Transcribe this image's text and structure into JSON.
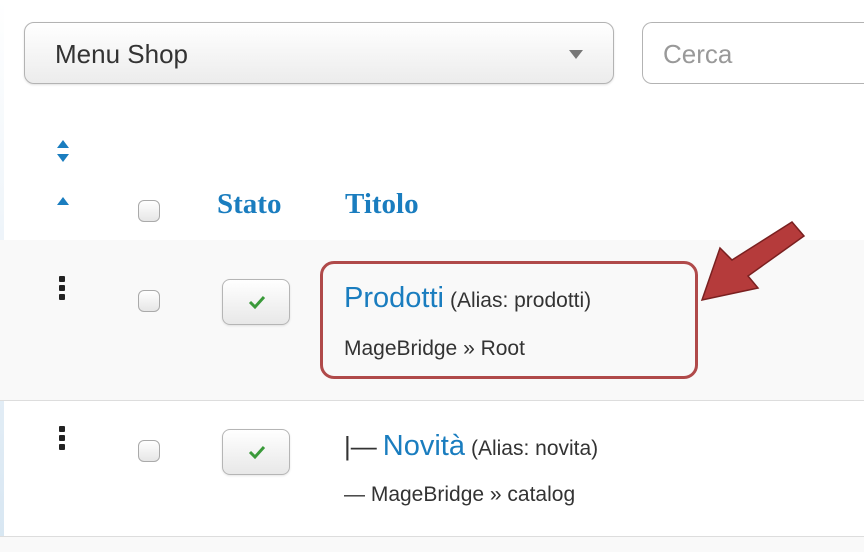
{
  "filter": {
    "menu_selected": "Menu Shop",
    "search_placeholder": "Cerca"
  },
  "table": {
    "columns": {
      "stato": "Stato",
      "titolo": "Titolo"
    },
    "rows": [
      {
        "prefix": "",
        "title": "Prodotti",
        "alias": "(Alias: prodotti)",
        "subtitle": "MageBridge » Root",
        "published": true
      },
      {
        "prefix": "|—",
        "title": "Novità",
        "alias": "(Alias: novita)",
        "subtitle": "— MageBridge » catalog",
        "published": true
      }
    ]
  },
  "colors": {
    "link": "#1a7dbf",
    "check": "#3a9a3a",
    "highlight": "#b04a4a"
  },
  "icons": [
    "sort-both-icon",
    "sort-up-icon",
    "drag-handle-icon",
    "checkmark-icon",
    "annotation-arrow"
  ]
}
